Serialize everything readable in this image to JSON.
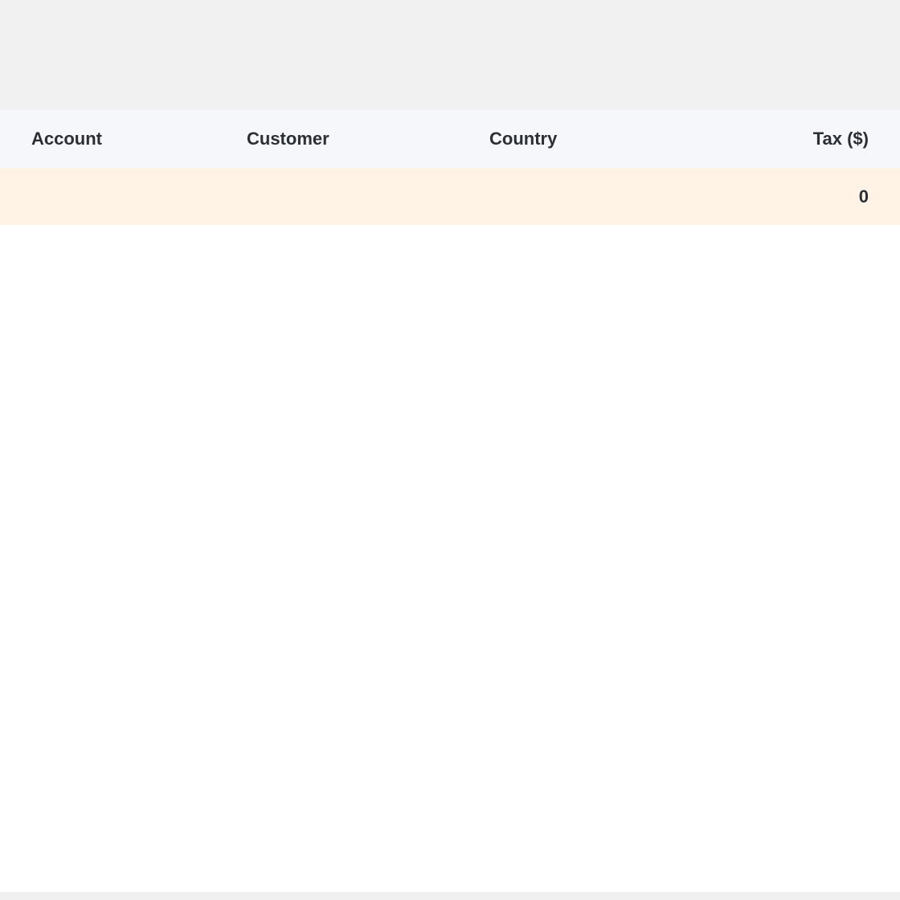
{
  "table": {
    "columns": {
      "account": "Account",
      "customer": "Customer",
      "country": "Country",
      "tax": "Tax ($)"
    },
    "summary_row": {
      "account": "",
      "customer": "",
      "country": "",
      "tax": "0"
    }
  },
  "colors": {
    "top_band": "#f1f1f1",
    "header_bg": "#f6f7fa",
    "summary_bg": "#fff3e6",
    "text": "#2b2f36"
  }
}
